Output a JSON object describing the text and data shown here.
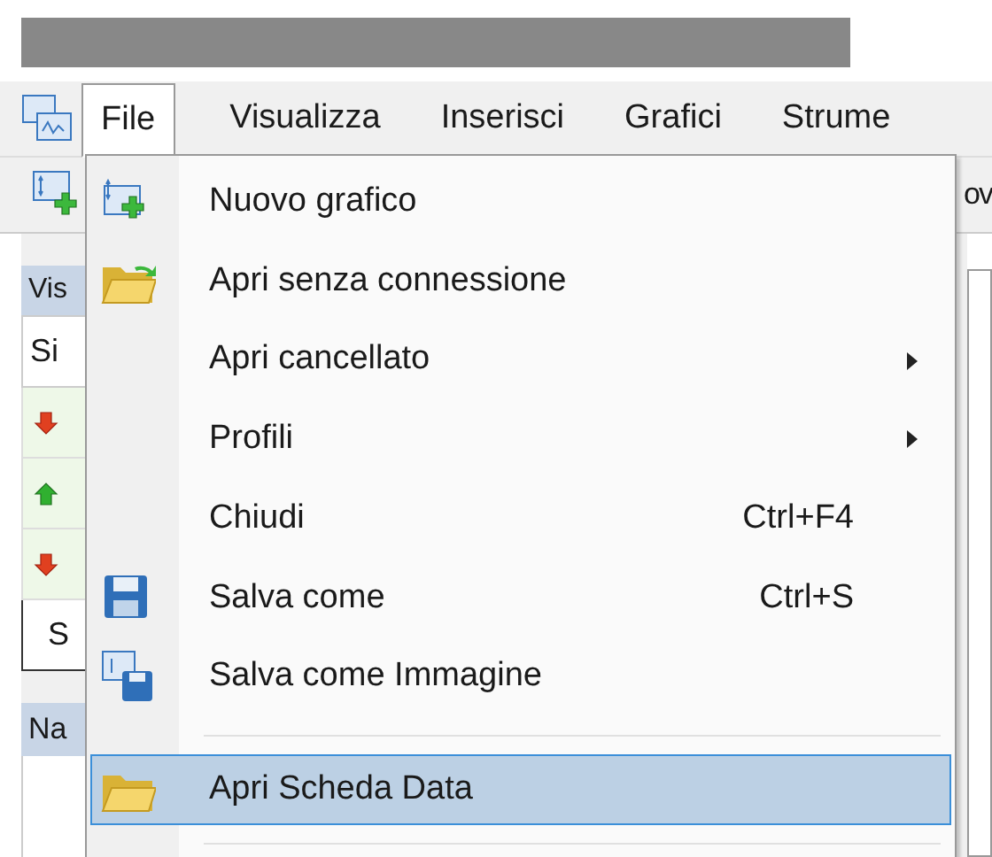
{
  "menu_bar": [
    {
      "label": "File",
      "selected": true
    },
    {
      "label": "Visualizza",
      "selected": false
    },
    {
      "label": "Inserisci",
      "selected": false
    },
    {
      "label": "Grafici",
      "selected": false
    },
    {
      "label": "Strume",
      "selected": false
    }
  ],
  "toolbar": {
    "text_1": "ov"
  },
  "left_panel": {
    "header": "Vis",
    "column": "Si",
    "rows": [
      {
        "kind": "down"
      },
      {
        "kind": "up"
      },
      {
        "kind": "down"
      }
    ],
    "tab": "S",
    "lower_header": "Na"
  },
  "file_menu": [
    {
      "kind": "item",
      "label": "Nuovo grafico",
      "submenu": false,
      "selected": false
    },
    {
      "kind": "item",
      "label": "Apri senza connessione",
      "submenu": false,
      "selected": false
    },
    {
      "kind": "item",
      "label": "Apri cancellato",
      "submenu": true,
      "selected": false
    },
    {
      "kind": "item",
      "label": "Profili",
      "submenu": true,
      "selected": false
    },
    {
      "kind": "item",
      "label": "Chiudi",
      "shortcut": "Ctrl+F4",
      "submenu": false,
      "selected": false
    },
    {
      "kind": "item",
      "label": "Salva come",
      "shortcut": "Ctrl+S",
      "submenu": false,
      "selected": false
    },
    {
      "kind": "item",
      "label": "Salva come Immagine",
      "submenu": false,
      "selected": false
    },
    {
      "kind": "separator"
    },
    {
      "kind": "item",
      "label": "Apri Scheda Data",
      "submenu": false,
      "selected": true
    },
    {
      "kind": "separator"
    }
  ]
}
